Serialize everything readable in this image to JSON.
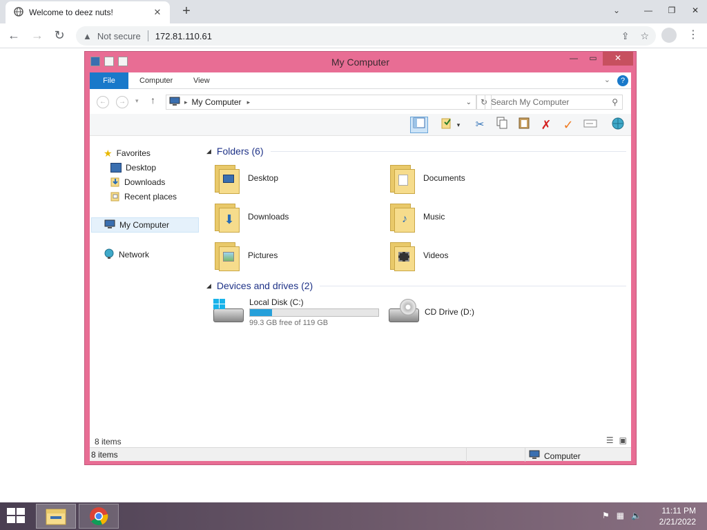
{
  "browser": {
    "tab_title": "Welcome to deez nuts!",
    "not_secure": "Not secure",
    "url": "172.81.110.61"
  },
  "window": {
    "title": "My Computer"
  },
  "ribbon": {
    "tabs": [
      "File",
      "Computer",
      "View"
    ]
  },
  "address": {
    "path": "My Computer",
    "search_placeholder": "Search My Computer"
  },
  "nav": {
    "favorites": "Favorites",
    "desktop": "Desktop",
    "downloads": "Downloads",
    "recent": "Recent places",
    "my_computer": "My Computer",
    "network": "Network"
  },
  "content": {
    "folders_header": "Folders (6)",
    "folders": [
      "Desktop",
      "Documents",
      "Downloads",
      "Music",
      "Pictures",
      "Videos"
    ],
    "devices_header": "Devices and drives (2)",
    "drives": [
      {
        "name": "Local Disk (C:)",
        "free": "99.3 GB free of 119 GB",
        "used_fraction": 0.17
      },
      {
        "name": "CD Drive (D:)"
      }
    ]
  },
  "footer": {
    "items_count": "8 items"
  },
  "status": {
    "items": "8 items",
    "location": "Computer"
  },
  "taskbar": {
    "time": "11:11 PM",
    "date": "2/21/2022"
  },
  "colors": {
    "window_frame": "#e86d94",
    "accent": "#1979ca",
    "group_header": "#1e3287",
    "drive_fill": "#26a0da"
  }
}
